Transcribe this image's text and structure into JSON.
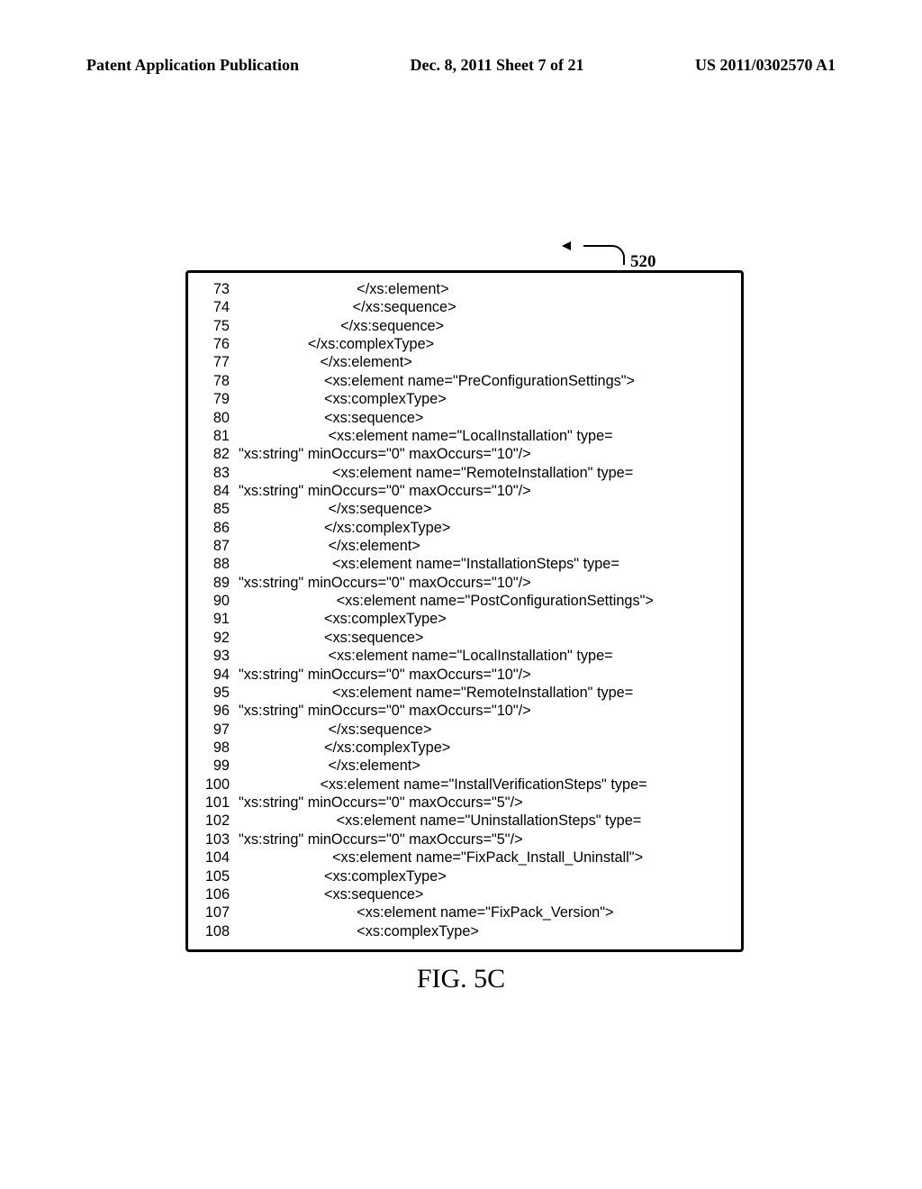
{
  "header": {
    "left": "Patent Application Publication",
    "center": "Dec. 8, 2011  Sheet 7 of 21",
    "right": "US 2011/0302570 A1"
  },
  "ref_num": "520",
  "caption": "FIG. 5C",
  "code": [
    {
      "n": "73",
      "t": "                             </xs:element>"
    },
    {
      "n": "74",
      "t": "                            </xs:sequence>"
    },
    {
      "n": "75",
      "t": "                         </xs:sequence>"
    },
    {
      "n": "76",
      "t": "                 </xs:complexType>"
    },
    {
      "n": "77",
      "t": "                    </xs:element>"
    },
    {
      "n": "78",
      "t": "                     <xs:element name=\"PreConfigurationSettings\">"
    },
    {
      "n": "79",
      "t": "                     <xs:complexType>"
    },
    {
      "n": "80",
      "t": "                     <xs:sequence>"
    },
    {
      "n": "81",
      "t": "                      <xs:element name=\"LocalInstallation\" type="
    },
    {
      "n": "82",
      "t": "\"xs:string\" minOccurs=\"0\" maxOccurs=\"10\"/>"
    },
    {
      "n": "83",
      "t": "                       <xs:element name=\"RemoteInstallation\" type="
    },
    {
      "n": "84",
      "t": "\"xs:string\" minOccurs=\"0\" maxOccurs=\"10\"/>"
    },
    {
      "n": "85",
      "t": "                      </xs:sequence>"
    },
    {
      "n": "86",
      "t": "                     </xs:complexType>"
    },
    {
      "n": "87",
      "t": "                      </xs:element>"
    },
    {
      "n": "88",
      "t": "                       <xs:element name=\"InstallationSteps\" type="
    },
    {
      "n": "89",
      "t": "\"xs:string\" minOccurs=\"0\" maxOccurs=\"10\"/>"
    },
    {
      "n": "90",
      "t": "                        <xs:element name=\"PostConfigurationSettings\">"
    },
    {
      "n": "91",
      "t": "                     <xs:complexType>"
    },
    {
      "n": "92",
      "t": "                     <xs:sequence>"
    },
    {
      "n": "93",
      "t": "                      <xs:element name=\"LocalInstallation\" type="
    },
    {
      "n": "94",
      "t": "\"xs:string\" minOccurs=\"0\" maxOccurs=\"10\"/>"
    },
    {
      "n": "95",
      "t": "                       <xs:element name=\"RemoteInstallation\" type="
    },
    {
      "n": "96",
      "t": "\"xs:string\" minOccurs=\"0\" maxOccurs=\"10\"/>"
    },
    {
      "n": "97",
      "t": "                      </xs:sequence>"
    },
    {
      "n": "98",
      "t": "                     </xs:complexType>"
    },
    {
      "n": "99",
      "t": "                      </xs:element>"
    },
    {
      "n": "100",
      "t": "                    <xs:element name=\"InstallVerificationSteps\" type="
    },
    {
      "n": "101",
      "t": "\"xs:string\" minOccurs=\"0\" maxOccurs=\"5\"/>"
    },
    {
      "n": "102",
      "t": "                        <xs:element name=\"UninstallationSteps\" type="
    },
    {
      "n": "103",
      "t": "\"xs:string\" minOccurs=\"0\" maxOccurs=\"5\"/>"
    },
    {
      "n": "104",
      "t": "                       <xs:element name=\"FixPack_Install_Uninstall\">"
    },
    {
      "n": "105",
      "t": "                     <xs:complexType>"
    },
    {
      "n": "106",
      "t": "                     <xs:sequence>"
    },
    {
      "n": "107",
      "t": "                             <xs:element name=\"FixPack_Version\">"
    },
    {
      "n": "108",
      "t": "                             <xs:complexType>"
    }
  ]
}
